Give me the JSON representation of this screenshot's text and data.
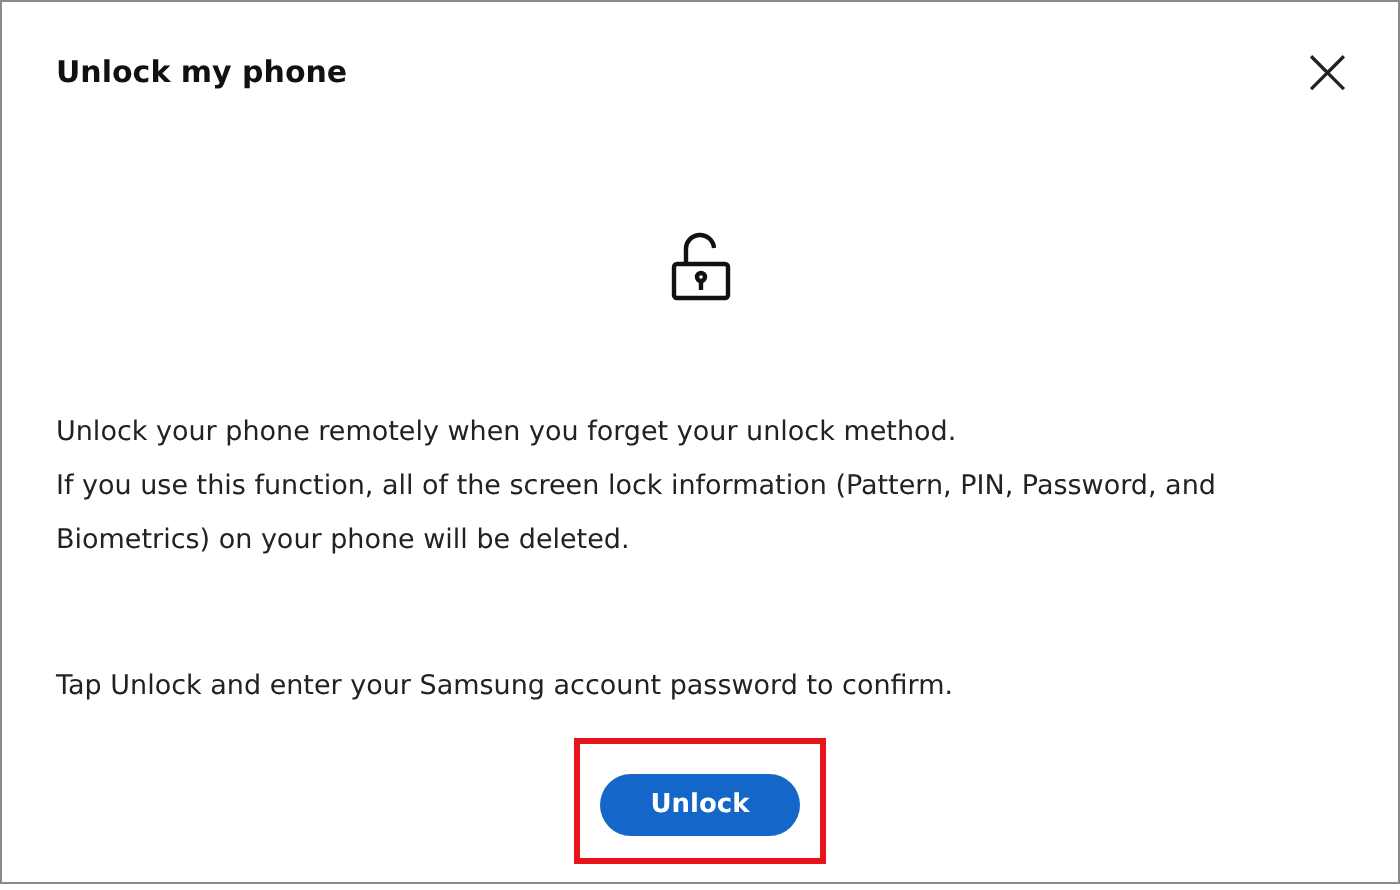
{
  "dialog": {
    "title": "Unlock my phone",
    "close": "×"
  },
  "paragraphs": [
    "Unlock your phone remotely when you forget your unlock method.",
    "If you use this function, all of the screen lock information (Pattern, PIN, Password, and Biometrics) on your phone will be deleted."
  ],
  "instruction": "Tap Unlock and enter your Samsung account password to confirm.",
  "button": {
    "label": "Unlock",
    "highlighted": true
  }
}
